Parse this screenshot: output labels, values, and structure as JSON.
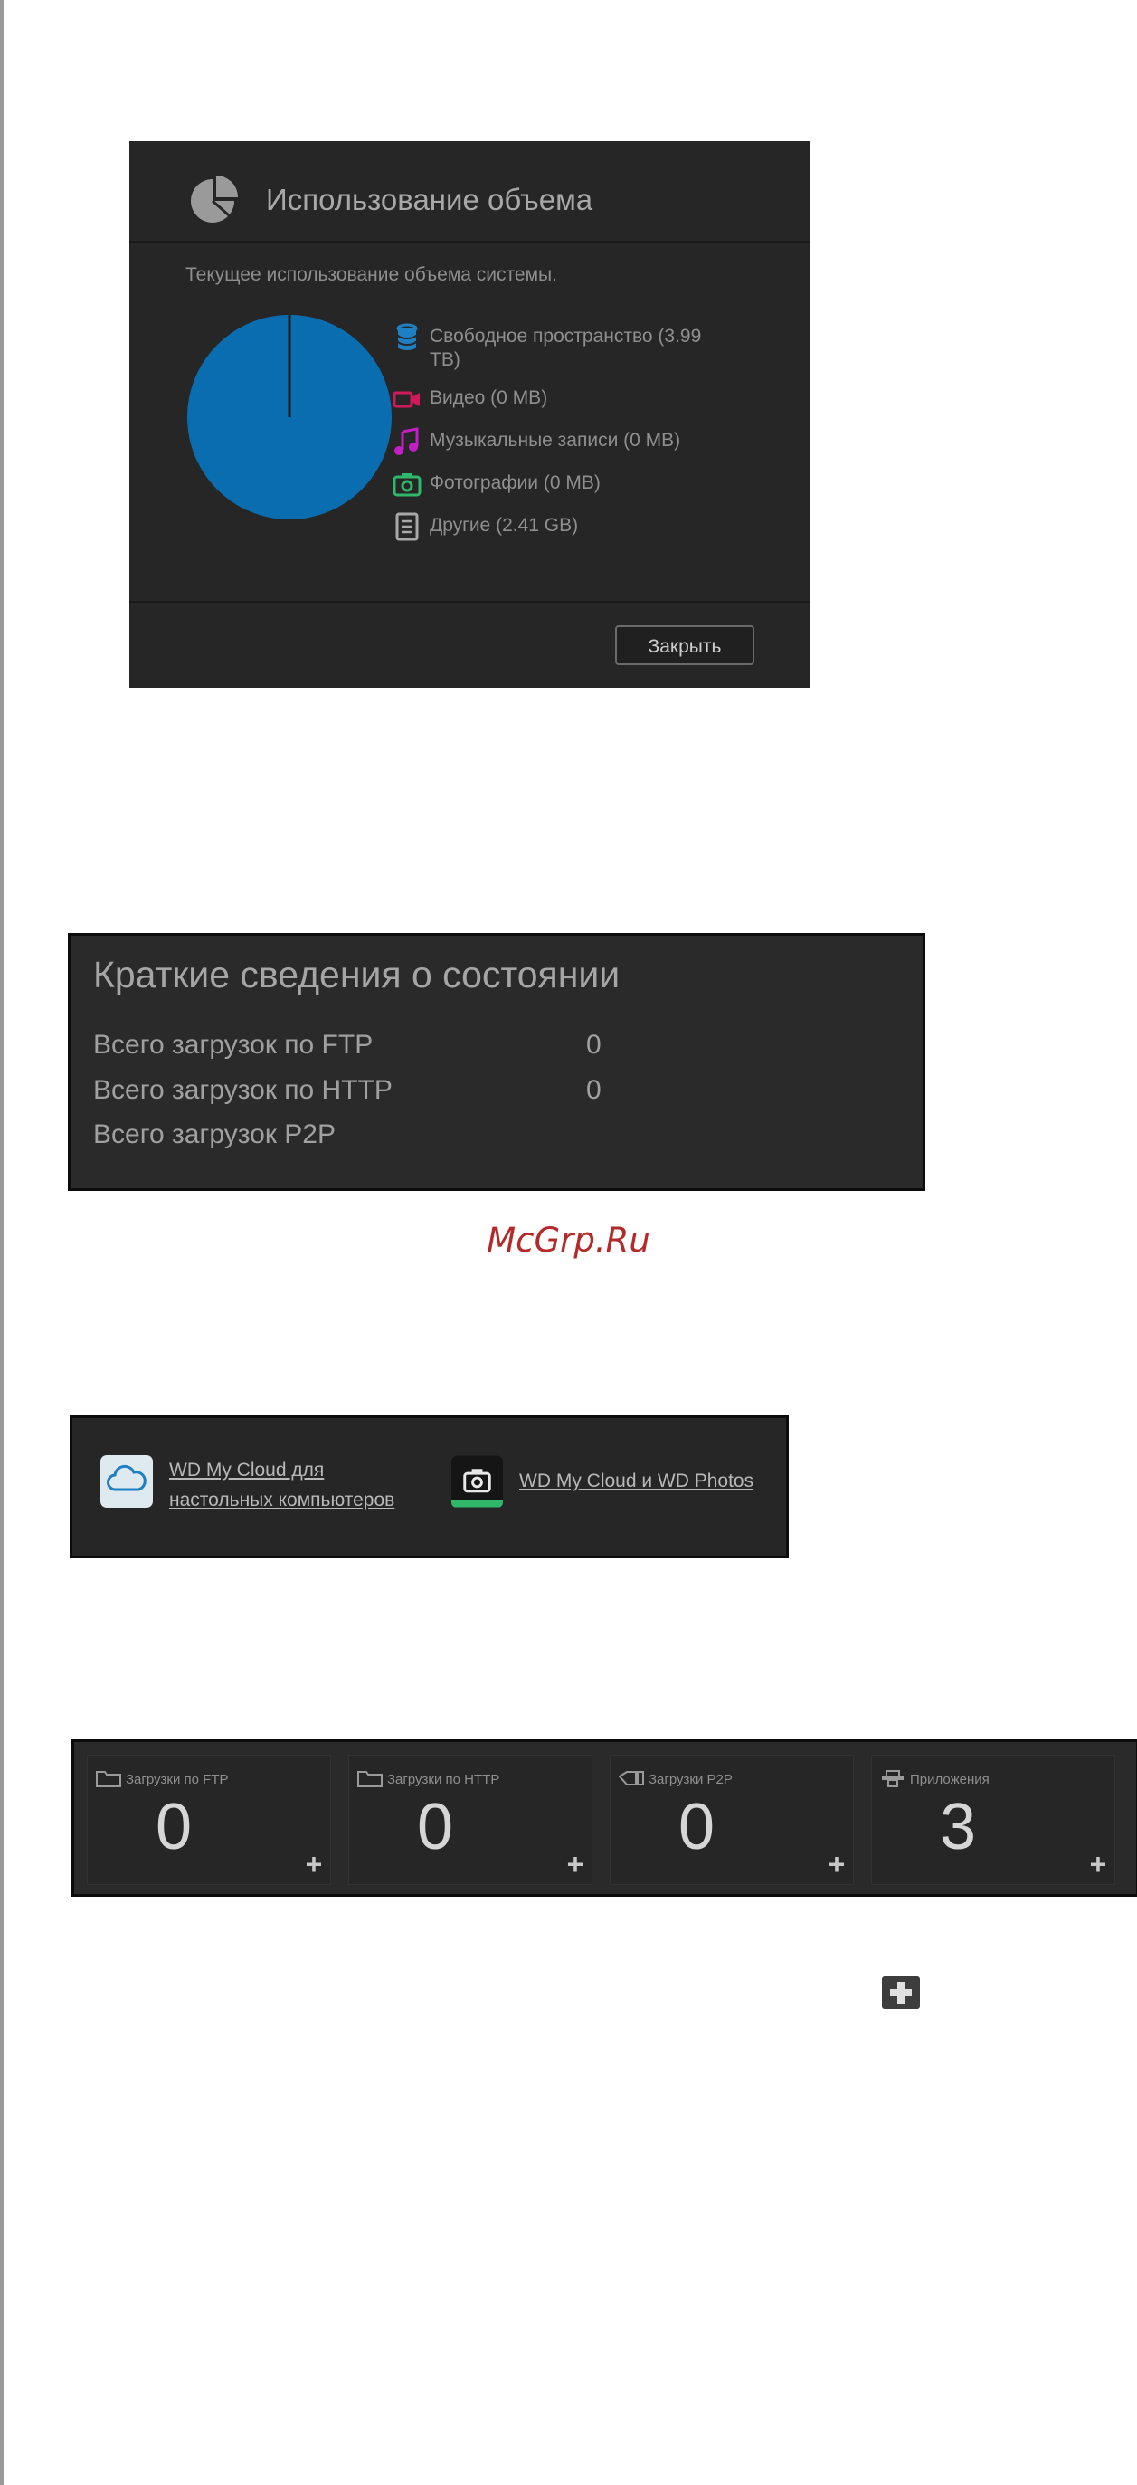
{
  "usage_dialog": {
    "title": "Использование объема",
    "description": "Текущее использование объема системы.",
    "legend": [
      {
        "label": "Свободное пространство (3.99 TB)",
        "icon": "database-icon",
        "color": "#1e7fc2"
      },
      {
        "label": "Видео (0 MB)",
        "icon": "video-icon",
        "color": "#d0195a"
      },
      {
        "label": "Музыкальные записи (0 MB)",
        "icon": "music-icon",
        "color": "#c41fc7"
      },
      {
        "label": "Фотографии (0 MB)",
        "icon": "camera-icon",
        "color": "#2fb86a"
      },
      {
        "label": "Другие (2.41 GB)",
        "icon": "document-icon",
        "color": "#a8a8a8"
      }
    ],
    "pie_color": "#0a6db0",
    "close_label": "Закрыть"
  },
  "status_summary": {
    "title": "Краткие сведения о состоянии",
    "rows": [
      {
        "label": "Всего загрузок по FTP",
        "value": "0"
      },
      {
        "label": "Всего загрузок по HTTP",
        "value": "0"
      },
      {
        "label": "Всего загрузок P2P",
        "value": ""
      }
    ]
  },
  "watermark": "McGrp.Ru",
  "apps": [
    {
      "label": "WD My Cloud для настольных компьютеров",
      "icon": "cloud-icon"
    },
    {
      "label": "WD My Cloud и WD Photos",
      "icon": "camera-icon"
    }
  ],
  "stats_tiles": [
    {
      "label": "Загрузки по FTP",
      "value": "0",
      "icon": "folder-icon"
    },
    {
      "label": "Загрузки по HTTP",
      "value": "0",
      "icon": "folder-icon"
    },
    {
      "label": "Загрузки P2P",
      "value": "0",
      "icon": "p2p-icon"
    },
    {
      "label": "Приложения",
      "value": "3",
      "icon": "apps-icon"
    }
  ]
}
